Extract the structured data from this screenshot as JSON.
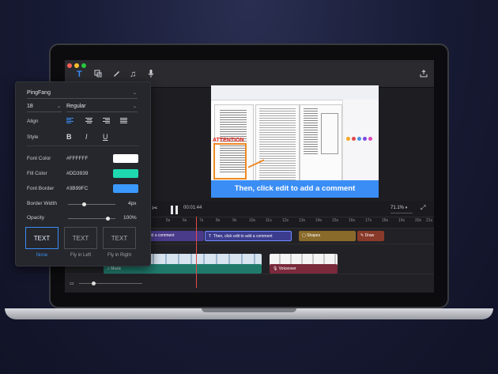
{
  "toolbar": {
    "icons": [
      "text-icon",
      "shapes-icon",
      "pen-icon",
      "music-icon",
      "mic-icon",
      "export-icon"
    ]
  },
  "preview": {
    "caption": "Then, click edit to add a comment",
    "annotation": "ATTENTION"
  },
  "playback": {
    "time": "00:01:44",
    "zoom": "71.1%"
  },
  "ruler": {
    "ticks": [
      "1s",
      "2s",
      "3s",
      "4s",
      "5s",
      "6s",
      "7s",
      "8s",
      "9s",
      "10s",
      "11s",
      "12s",
      "13s",
      "14s",
      "15s",
      "16s",
      "17s",
      "18s",
      "19s",
      "20s",
      "21s"
    ]
  },
  "timeline": {
    "clips": [
      {
        "label": "add a comment",
        "color": "#4a3a8a"
      },
      {
        "label": "Then,  click edit to add a comment",
        "color": "#3c3c8f"
      },
      {
        "label": "Shapes",
        "color": "#8a6a2a"
      },
      {
        "label": "Draw",
        "color": "#8a3a2a"
      },
      {
        "label": "Music",
        "color": "#1f7a6c"
      },
      {
        "label": "Voiceover",
        "color": "#7a2a3a"
      }
    ]
  },
  "panel": {
    "font_family": "PingFang",
    "font_size": "18",
    "font_weight": "Regular",
    "align_label": "Align",
    "style_label": "Style",
    "style_bold": "B",
    "style_italic": "I",
    "style_underline": "U",
    "font_color_label": "Font Color",
    "font_color": "#FFFFFF",
    "fill_color_label": "Fill Color",
    "fill_color": "#DD3939",
    "font_border_label": "Font Border",
    "font_border": "#3B99FC",
    "border_width_label": "Border Width",
    "border_width": "4px",
    "opacity_label": "Opacity",
    "opacity": "100%",
    "text_buttons": [
      {
        "label": "TEXT",
        "caption": "None"
      },
      {
        "label": "TEXT",
        "caption": "Fly in Left"
      },
      {
        "label": "TEXT",
        "caption": "Fly in Right"
      }
    ]
  },
  "colors": {
    "font_color_swatch": "#FFFFFF",
    "fill_color_swatch": "#1ED8B0",
    "font_border_swatch": "#3B99FC",
    "accent": "#3A8DF5"
  }
}
